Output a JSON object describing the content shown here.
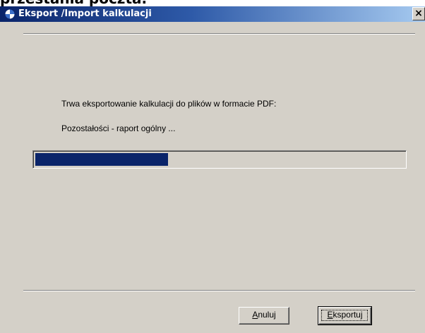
{
  "background_text": "przestania poczta.",
  "window": {
    "title": "Eksport /Import kalkulacji",
    "close_glyph": "×"
  },
  "message": {
    "line1": "Trwa eksportowanie kalkulacji do plików w formacie PDF:",
    "line2": "Pozostałości - raport ogólny ..."
  },
  "progress": {
    "fraction": 0.36,
    "color": "#0a246a"
  },
  "buttons": {
    "cancel": {
      "mnemonic": "A",
      "rest": "nuluj"
    },
    "export": {
      "mnemonic": "E",
      "rest": "ksportuj"
    }
  },
  "icons": {
    "app": "app-logo-icon",
    "close": "close-icon"
  }
}
